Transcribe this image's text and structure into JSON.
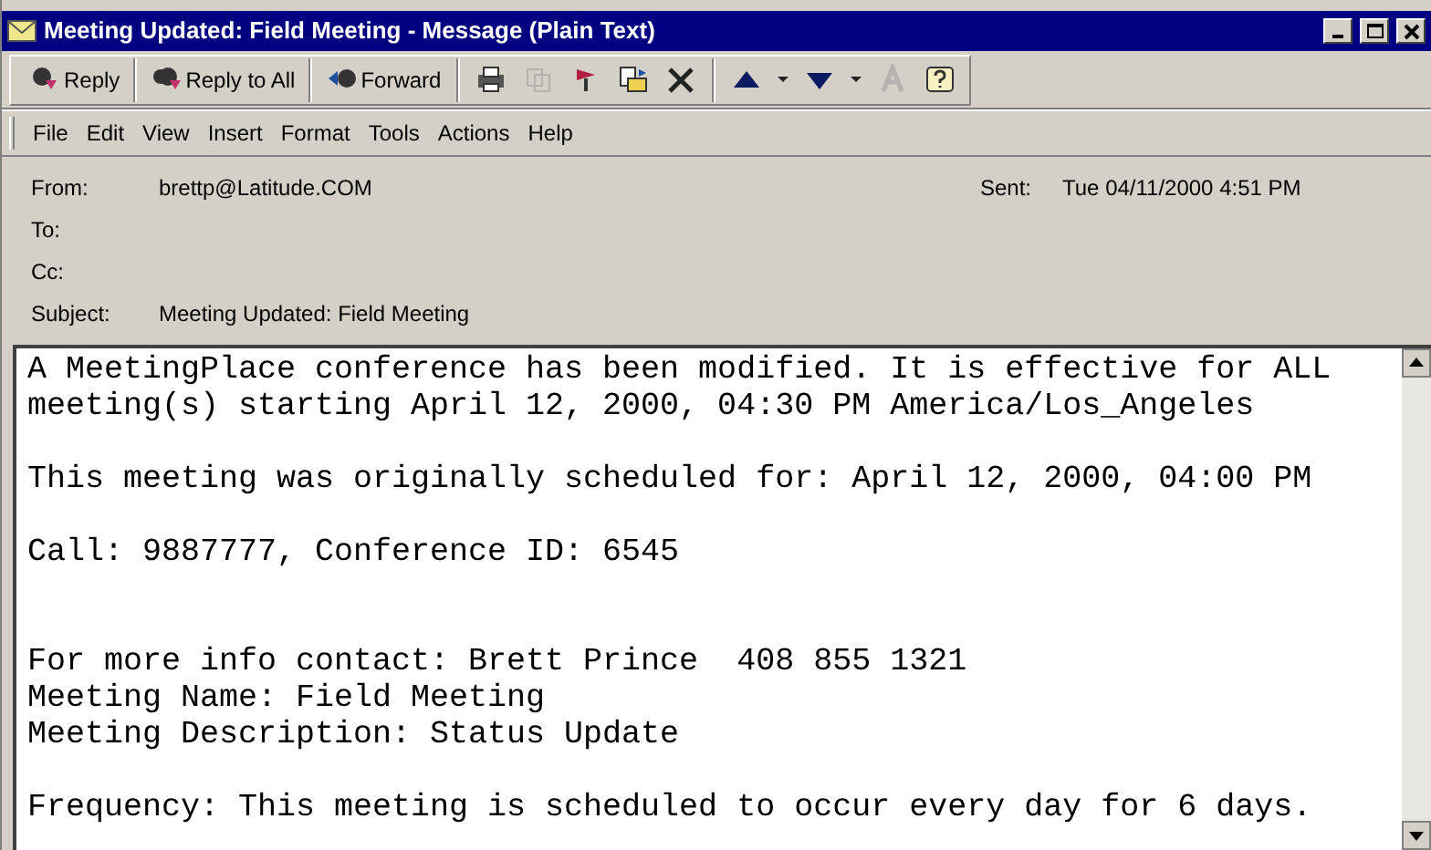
{
  "window": {
    "title": "Meeting Updated:  Field Meeting - Message (Plain Text)"
  },
  "toolbar": [
    {
      "kind": "reply",
      "label": "Reply",
      "disabled": false
    },
    {
      "kind": "replyall",
      "label": "Reply to All",
      "disabled": false
    },
    {
      "kind": "forward",
      "label": "Forward",
      "disabled": false
    },
    {
      "kind": "sep"
    },
    {
      "kind": "print",
      "disabled": false
    },
    {
      "kind": "copy",
      "disabled": true
    },
    {
      "kind": "flag",
      "disabled": false
    },
    {
      "kind": "move",
      "disabled": false
    },
    {
      "kind": "delete",
      "disabled": false
    },
    {
      "kind": "sep"
    },
    {
      "kind": "up",
      "disabled": false
    },
    {
      "kind": "drop",
      "disabled": false
    },
    {
      "kind": "down",
      "disabled": false
    },
    {
      "kind": "drop",
      "disabled": false
    },
    {
      "kind": "font",
      "disabled": true
    },
    {
      "kind": "help",
      "disabled": false
    }
  ],
  "menu": [
    "File",
    "Edit",
    "View",
    "Insert",
    "Format",
    "Tools",
    "Actions",
    "Help"
  ],
  "header": {
    "from_label": "From:",
    "from": "brettp@Latitude.COM",
    "sent_label": "Sent:",
    "sent": "Tue 04/11/2000 4:51 PM",
    "to_label": "To:",
    "cc_label": "Cc:",
    "subject_label": "Subject:",
    "subject": "Meeting Updated: Field Meeting"
  },
  "body": [
    [
      "A MeetingPlace conference has been modified. It is effective for ALL",
      "meeting(s) starting April 12, 2000, 04:30 PM America/Los_Angeles"
    ],
    [
      "This meeting was originally scheduled for: April 12, 2000, 04:00 PM"
    ],
    [
      "Call: 9887777, Conference ID: 6545"
    ],
    [
      "For more info contact: Brett Prince  408 855 1321",
      "Meeting Name: Field Meeting",
      "Meeting Description: Status Update"
    ],
    [
      "Frequency: This meeting is scheduled to occur every day for 6 days."
    ]
  ]
}
